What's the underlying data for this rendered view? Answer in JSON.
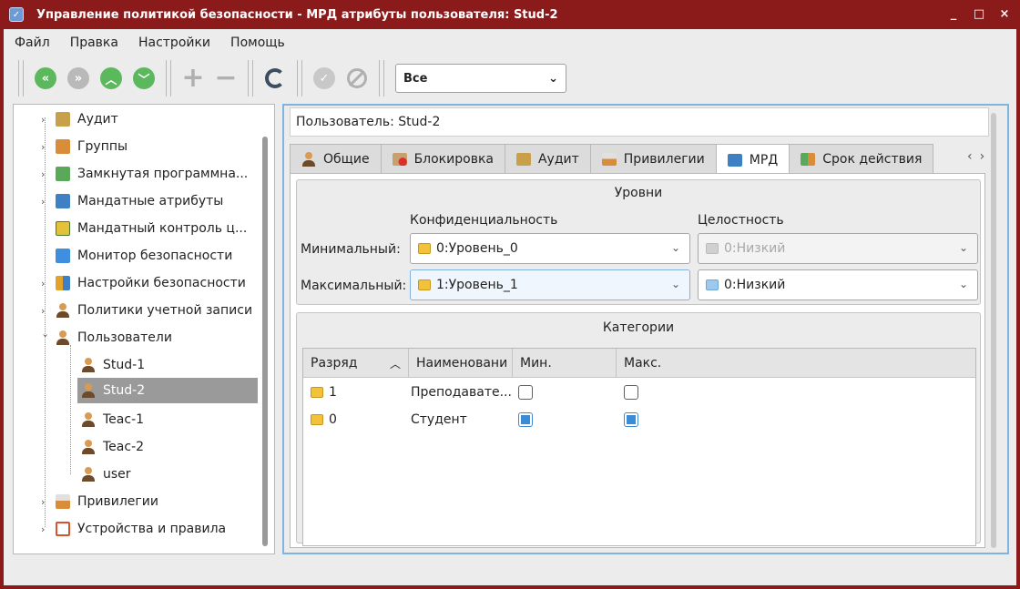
{
  "window": {
    "title": "Управление политикой безопасности - МРД атрибуты пользователя: Stud-2",
    "controls": [
      "_",
      "□",
      "×"
    ]
  },
  "menu": [
    "Файл",
    "Правка",
    "Настройки",
    "Помощь"
  ],
  "toolbar": {
    "filter_value": "Все"
  },
  "tree": {
    "items": [
      {
        "label": "Аудит",
        "icon": "audit-icon"
      },
      {
        "label": "Группы",
        "icon": "groups-icon"
      },
      {
        "label": "Замкнутая программна...",
        "icon": "closed-software-icon"
      },
      {
        "label": "Мандатные атрибуты",
        "icon": "mandatory-attributes-icon"
      },
      {
        "label": "Мандатный контроль ц...",
        "icon": "mandatory-control-icon"
      },
      {
        "label": "Монитор безопасности",
        "icon": "lock-icon"
      },
      {
        "label": "Настройки безопасности",
        "icon": "security-settings-icon"
      },
      {
        "label": "Политики учетной записи",
        "icon": "account-policy-icon"
      },
      {
        "label": "Пользователи",
        "icon": "users-icon"
      },
      {
        "label": "Stud-1",
        "icon": "user-icon"
      },
      {
        "label": "Stud-2",
        "icon": "user-icon"
      },
      {
        "label": "Teac-1",
        "icon": "user-icon"
      },
      {
        "label": "Teac-2",
        "icon": "user-icon"
      },
      {
        "label": "user",
        "icon": "user-icon"
      },
      {
        "label": "Привилегии",
        "icon": "privileges-icon"
      },
      {
        "label": "Устройства и правила",
        "icon": "devices-icon"
      }
    ]
  },
  "panel": {
    "user_label": "Пользователь: Stud-2",
    "tabs": [
      "Общие",
      "Блокировка",
      "Аудит",
      "Привилегии",
      "МРД",
      "Срок действия"
    ],
    "active_tab": "МРД",
    "levels": {
      "title": "Уровни",
      "conf_header": "Конфиденциальность",
      "integrity_header": "Целостность",
      "min_label": "Минимальный:",
      "max_label": "Максимальный:",
      "min_conf": "0:Уровень_0",
      "max_conf": "1:Уровень_1",
      "min_integrity": "0:Низкий",
      "max_integrity": "0:Низкий"
    },
    "categories": {
      "title": "Категории",
      "columns": [
        "Разряд",
        "Наименовани",
        "Мин.",
        "Макс."
      ],
      "rows": [
        {
          "bit": "1",
          "name": "Преподавате...",
          "min": false,
          "max": false
        },
        {
          "bit": "0",
          "name": "Студент",
          "min": true,
          "max": true
        }
      ]
    }
  },
  "colors": {
    "titlebar": "#8b1a1a",
    "accent": "#3c8bd6",
    "nav_green": "#5cb85c"
  }
}
